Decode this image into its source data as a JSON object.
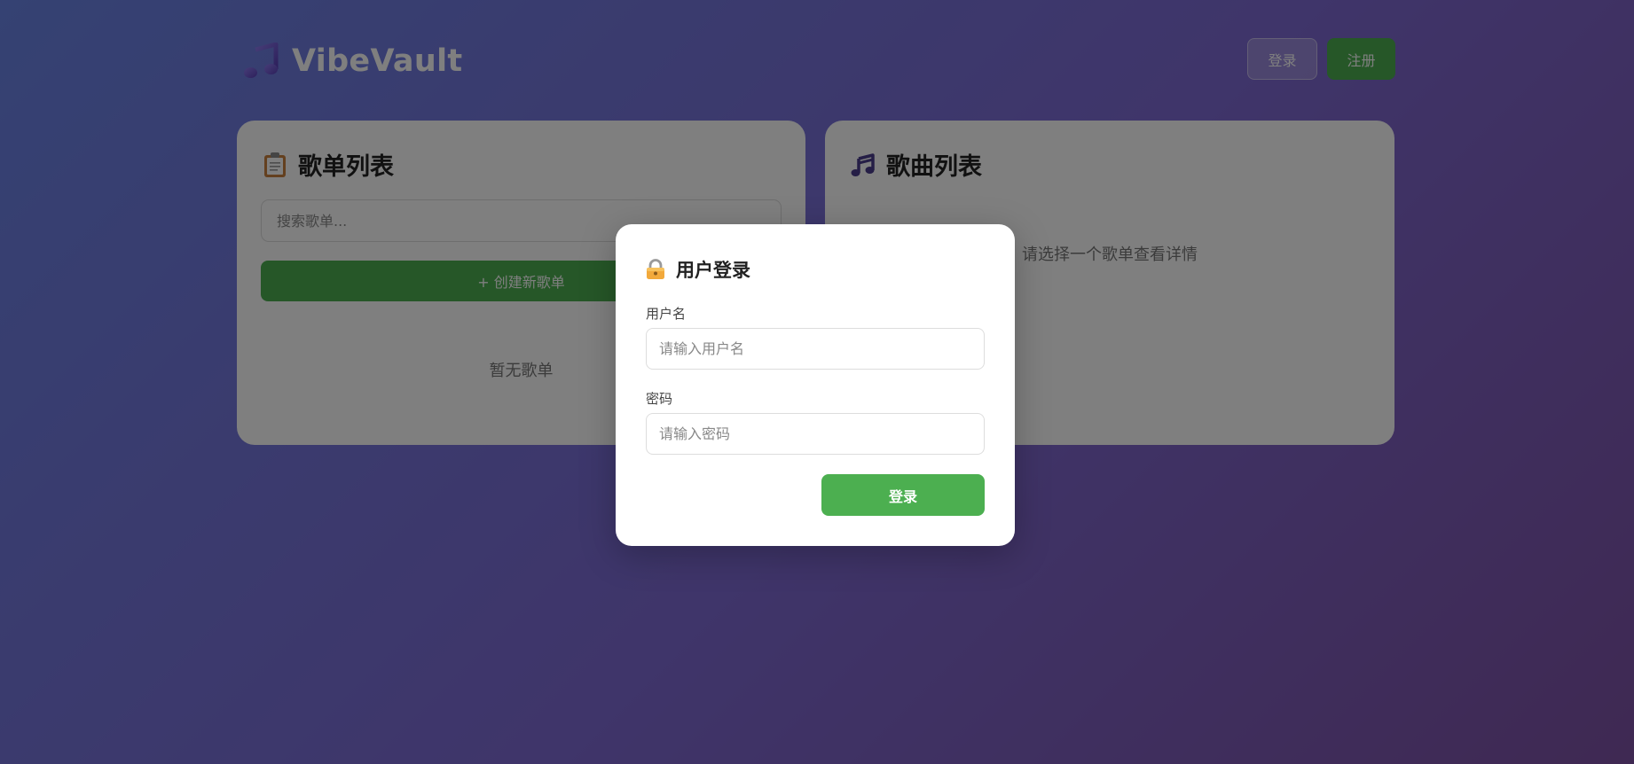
{
  "header": {
    "logo_icon": "music-note-icon",
    "title": "VibeVault",
    "login_label": "登录",
    "register_label": "注册"
  },
  "playlists_panel": {
    "icon": "clipboard-icon",
    "title": "歌单列表",
    "search_placeholder": "搜索歌单...",
    "create_label": "+ 创建新歌单",
    "empty_text": "暂无歌单"
  },
  "songs_panel": {
    "icon": "music-notes-icon",
    "title": "歌曲列表",
    "empty_text": "请选择一个歌单查看详情"
  },
  "login_modal": {
    "icon": "lock-icon",
    "title": "用户登录",
    "username_label": "用户名",
    "username_placeholder": "请输入用户名",
    "password_label": "密码",
    "password_placeholder": "请输入密码",
    "submit_label": "登录"
  },
  "colors": {
    "accent_green": "#4caf50",
    "background_gradient_start": "#6a84e6",
    "background_gradient_end": "#7e52a6"
  }
}
